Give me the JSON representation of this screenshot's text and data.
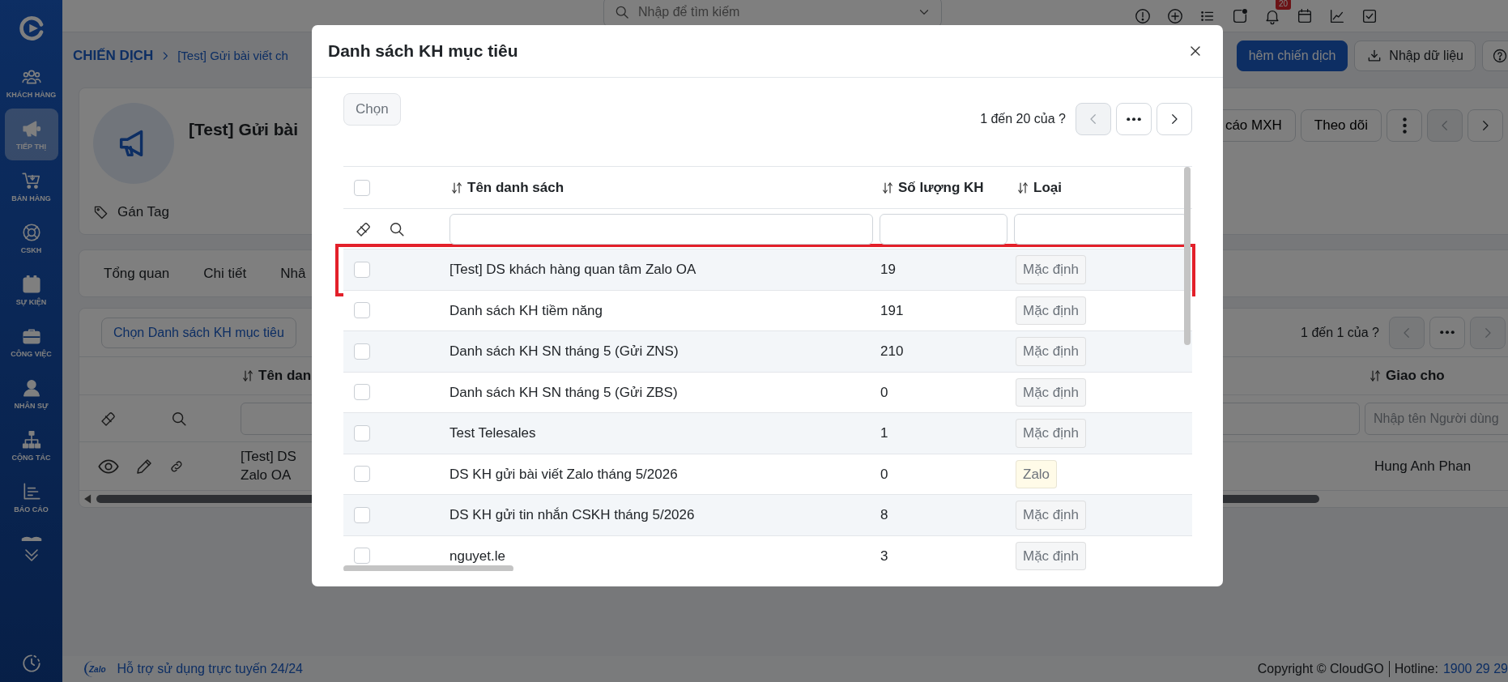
{
  "sidebar": {
    "items": [
      {
        "label": "KHÁCH HÀNG",
        "selected": false
      },
      {
        "label": "TIẾP THỊ",
        "selected": true
      },
      {
        "label": "BÁN HÀNG",
        "selected": false
      },
      {
        "label": "CSKH",
        "selected": false
      },
      {
        "label": "SỰ KIỆN",
        "selected": false
      },
      {
        "label": "CÔNG VIỆC",
        "selected": false
      },
      {
        "label": "NHÂN SỰ",
        "selected": false
      },
      {
        "label": "CỘNG TÁC",
        "selected": false
      },
      {
        "label": "BÁO CÁO",
        "selected": false
      }
    ]
  },
  "topbar": {
    "search": {
      "placeholder": "Nhập để tìm kiếm"
    },
    "notification_count": "20"
  },
  "breadcrumb": {
    "section": "CHIẾN DỊCH",
    "current": "[Test] Gửi bài viết ch"
  },
  "page_actions": [
    {
      "label": "hêm chiến dịch",
      "kind": "primary"
    },
    {
      "label": "Nhập dữ liệu",
      "kind": "import"
    }
  ],
  "campaign": {
    "title": "[Test] Gửi bài",
    "tag_label": "Gán Tag",
    "actions": [
      "cáo MXH",
      "Theo dõi"
    ],
    "prev_disabled": true,
    "next_disabled": false
  },
  "tabs": [
    {
      "label": "Tổng quan"
    },
    {
      "label": "Chi tiết"
    },
    {
      "label": "Nhâ"
    }
  ],
  "target_lists": {
    "choose_button": "Chọn Danh sách KH mục tiêu",
    "pager": {
      "text": "1 đến 1 của ?",
      "prev_disabled": true,
      "next_disabled": true
    },
    "columns": [
      "Tên dan",
      "Giao cho"
    ],
    "filter_placeholder": "Nhập tên Người dùng",
    "rows": [
      {
        "name_parts": [
          "[Test] DS",
          "Zalo OA"
        ],
        "assignee": "Hung Anh Phan"
      }
    ]
  },
  "footer": {
    "logo_text": "Zalo",
    "support": "Hỗ trợ sử dụng trực tuyến 24/24",
    "copyright": "Copyright © CloudGO",
    "hotline_label": "Hotline:",
    "hotline": "1900 29 29"
  },
  "modal": {
    "title": "Danh sách KH mục tiêu",
    "choose_button": {
      "label": "Chọn",
      "disabled": true
    },
    "pager": {
      "text": "1 đến 20 của ?",
      "prev_disabled": true,
      "next_disabled": false
    },
    "select_all_checked": false,
    "columns": [
      "Tên danh sách",
      "Số lượng KH",
      "Loại"
    ],
    "rows": [
      {
        "name": "[Test] DS khách hàng quan tâm Zalo OA",
        "count": "19",
        "type": "Mặc định",
        "color": "#f5f6f7",
        "checked": false,
        "highlighted": true
      },
      {
        "name": "Danh sách KH tiềm năng",
        "count": "191",
        "type": "Mặc định",
        "color": "#f5f6f7",
        "checked": false,
        "highlighted": false
      },
      {
        "name": "Danh sách KH SN tháng 5 (Gửi ZNS)",
        "count": "210",
        "type": "Mặc định",
        "color": "#f5f6f7",
        "checked": false,
        "highlighted": false
      },
      {
        "name": "Danh sách KH SN tháng 5 (Gửi ZBS)",
        "count": "0",
        "type": "Mặc định",
        "color": "#f5f6f7",
        "checked": false,
        "highlighted": false
      },
      {
        "name": "Test Telesales",
        "count": "1",
        "type": "Mặc định",
        "color": "#f5f6f7",
        "checked": false,
        "highlighted": false
      },
      {
        "name": "DS KH gửi bài viết Zalo tháng 5/2026",
        "count": "0",
        "type": "Zalo",
        "color": "#fffbe8",
        "checked": false,
        "highlighted": false
      },
      {
        "name": "DS KH gửi tin nhắn CSKH tháng 5/2026",
        "count": "8",
        "type": "Mặc định",
        "color": "#f5f6f7",
        "checked": false,
        "highlighted": false
      },
      {
        "name": "nguyet.le",
        "count": "3",
        "type": "Mặc định",
        "color": "#f5f6f7",
        "checked": false,
        "highlighted": false
      }
    ]
  }
}
